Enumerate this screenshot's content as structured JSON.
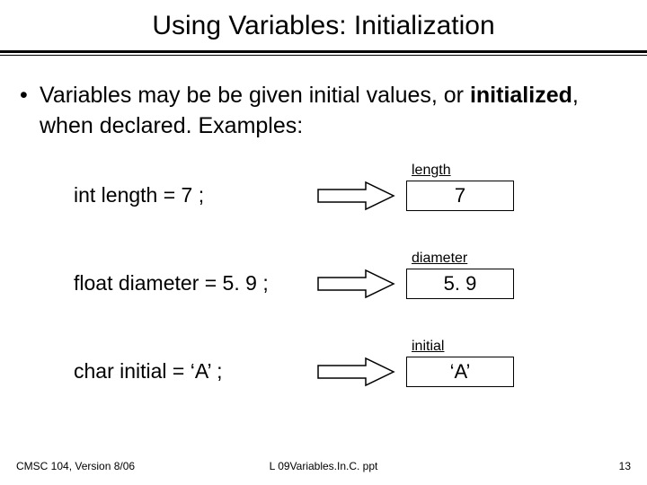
{
  "title": "Using Variables: Initialization",
  "bullet": {
    "marker": "•",
    "text_part1": "Variables may be be given initial values, or ",
    "bold_word": "initialized",
    "text_part2": ", when declared.  Examples:"
  },
  "examples": [
    {
      "code": "int length = 7 ;",
      "label": "length",
      "value": "7"
    },
    {
      "code": "float diameter = 5. 9 ;",
      "label": "diameter",
      "value": "5. 9"
    },
    {
      "code": "char initial = ‘A’ ;",
      "label": "initial",
      "value": "‘A’"
    }
  ],
  "footer": {
    "left": "CMSC 104, Version 8/06",
    "center": "L 09Variables.In.C. ppt",
    "right": "13"
  }
}
